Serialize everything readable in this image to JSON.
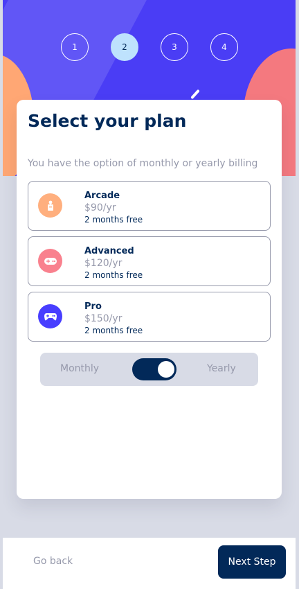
{
  "steps": [
    "1",
    "2",
    "3",
    "4"
  ],
  "active_step": "2",
  "heading": {
    "title": "Select your plan",
    "subtitle": "You have the option of monthly or yearly billing"
  },
  "plans": [
    {
      "name": "Arcade",
      "price": "$90/yr",
      "promo": "2 months free",
      "icon": "arcade-icon",
      "color": "#ffaf7e"
    },
    {
      "name": "Advanced",
      "price": "$120/yr",
      "promo": "2 months free",
      "icon": "advanced-icon",
      "color": "#f9818e"
    },
    {
      "name": "Pro",
      "price": "$150/yr",
      "promo": "2 months free",
      "icon": "pro-icon",
      "color": "#483eff"
    }
  ],
  "billing": {
    "monthly_label": "Monthly",
    "yearly_label": "Yearly",
    "selected": "Yearly"
  },
  "footer": {
    "back_label": "Go back",
    "next_label": "Next Step"
  },
  "colors": {
    "primary": "#022959",
    "accent": "#483eff",
    "muted": "#9699ab",
    "background": "#d8dbe6",
    "step_active": "#bee2fd"
  }
}
